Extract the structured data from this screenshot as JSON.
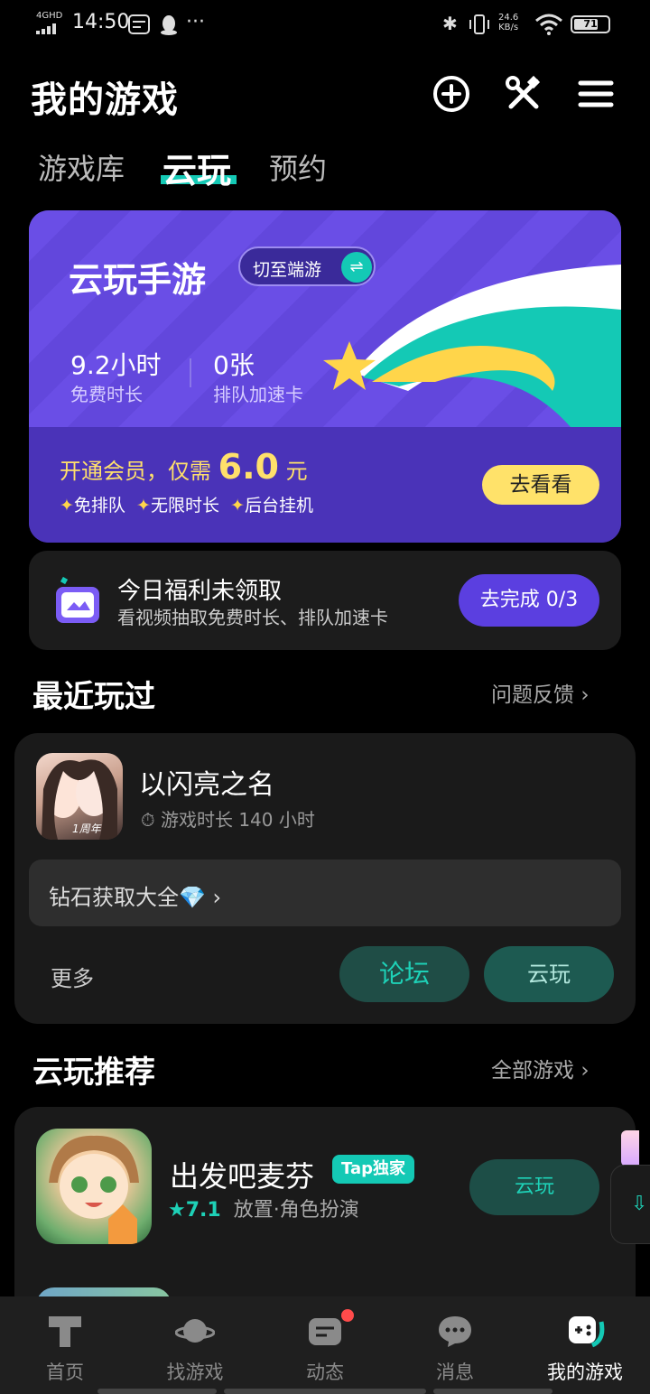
{
  "status_bar": {
    "network": "4GHD",
    "time": "14:50",
    "speed_value": "24.6",
    "speed_unit": "KB/s",
    "battery": "71",
    "more": "···"
  },
  "header": {
    "title": "我的游戏"
  },
  "tabs": [
    {
      "label": "游戏库",
      "active": false
    },
    {
      "label": "云玩",
      "active": true
    },
    {
      "label": "预约",
      "active": false
    }
  ],
  "promo": {
    "title": "云玩手游",
    "switch_label": "切至端游",
    "switch_icon": "⇌",
    "free_time_value": "9.2小时",
    "free_time_label": "免费时长",
    "queue_card_value": "0张",
    "queue_card_label": "排队加速卡",
    "member_prefix": "开通会员，仅需",
    "member_price": "6.0",
    "member_unit": "元",
    "perks": [
      "免排队",
      "无限时长",
      "后台挂机"
    ],
    "look_button": "去看看",
    "colors": {
      "bg": "#6247dc",
      "accent": "#14c9b5",
      "gold": "#ffe26a"
    }
  },
  "welfare": {
    "title": "今日福利未领取",
    "subtitle": "看视频抽取免费时长、排队加速卡",
    "button": "去完成 0/3"
  },
  "recent": {
    "section_title": "最近玩过",
    "feedback_link": "问题反馈",
    "game": {
      "name": "以闪亮之名",
      "playtime": "游戏时长 140 小时",
      "avatar_badge": "1周年"
    },
    "diamond_bar": "钻石获取大全💎",
    "more_label": "更多",
    "forum_button": "论坛",
    "cloud_button": "云玩"
  },
  "recommend": {
    "section_title": "云玩推荐",
    "all_games_link": "全部游戏",
    "game": {
      "name": "出发吧麦芬",
      "tag": "Tap独家",
      "score": "7.1",
      "genres": "放置·角色扮演",
      "cloud_button": "云玩"
    }
  },
  "bottom_nav": [
    {
      "label": "首页",
      "icon": "tap-logo-icon",
      "active": false
    },
    {
      "label": "找游戏",
      "icon": "planet-icon",
      "active": false
    },
    {
      "label": "动态",
      "icon": "message-card-icon",
      "active": false,
      "badge": true
    },
    {
      "label": "消息",
      "icon": "chat-bubble-icon",
      "active": false
    },
    {
      "label": "我的游戏",
      "icon": "gamepad-icon",
      "active": true
    }
  ]
}
